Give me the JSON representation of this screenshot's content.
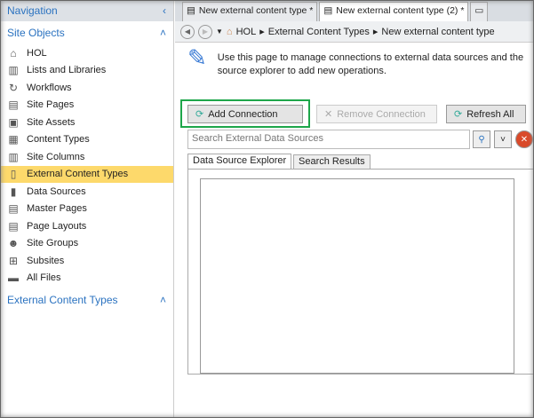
{
  "sidebar": {
    "title": "Navigation",
    "section": "Site Objects",
    "items": [
      {
        "label": "HOL",
        "icon": "⌂"
      },
      {
        "label": "Lists and Libraries",
        "icon": "▥"
      },
      {
        "label": "Workflows",
        "icon": "↻"
      },
      {
        "label": "Site Pages",
        "icon": "▤"
      },
      {
        "label": "Site Assets",
        "icon": "▣"
      },
      {
        "label": "Content Types",
        "icon": "▦"
      },
      {
        "label": "Site Columns",
        "icon": "▥"
      },
      {
        "label": "External Content Types",
        "icon": "▯"
      },
      {
        "label": "Data Sources",
        "icon": "▮"
      },
      {
        "label": "Master Pages",
        "icon": "▤"
      },
      {
        "label": "Page Layouts",
        "icon": "▤"
      },
      {
        "label": "Site Groups",
        "icon": "☻"
      },
      {
        "label": "Subsites",
        "icon": "⊞"
      },
      {
        "label": "All Files",
        "icon": "▬"
      }
    ],
    "section2": "External Content Types"
  },
  "tabs": [
    "New external content type *",
    "New external content type (2) *"
  ],
  "breadcrumb": [
    "HOL",
    "External Content Types",
    "New external content type"
  ],
  "intro": "Use this page to manage connections to external data sources and the\nsource explorer to add new operations.",
  "toolbar": {
    "add": "Add Connection",
    "remove": "Remove Connection",
    "refresh": "Refresh All"
  },
  "search": {
    "placeholder": "Search External Data Sources"
  },
  "panel_tabs": [
    "Data Source Explorer",
    "Search Results"
  ]
}
